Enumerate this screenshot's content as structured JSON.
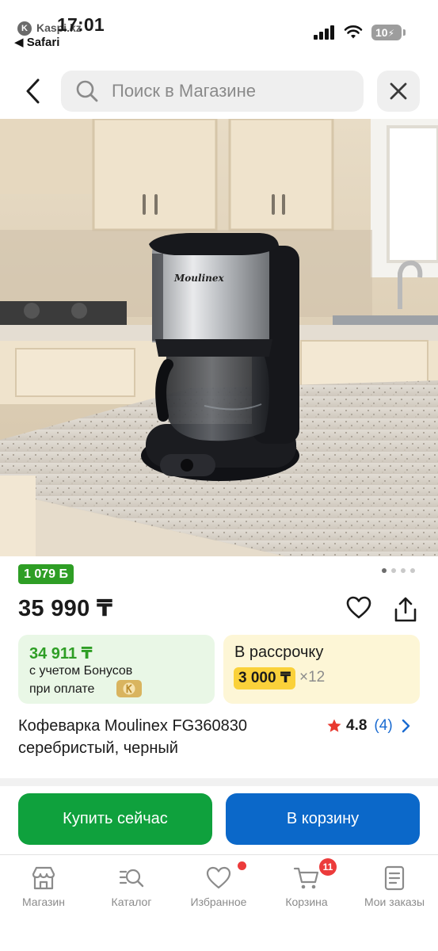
{
  "status_bar": {
    "time": "17:01",
    "app_name": "Kaspi.kz",
    "back_app": "◀ Safari",
    "battery": "10"
  },
  "header": {
    "search_placeholder": "Поиск в Магазине"
  },
  "product": {
    "bonus_badge": "1 079 Б",
    "price": "35 990 ₸",
    "bonus_card": {
      "amount": "34 911 ₸",
      "line1": "с учетом Бонусов",
      "line2": "при оплате"
    },
    "installment_card": {
      "title": "В рассрочку",
      "monthly": "3 000 ₸",
      "months": "×12"
    },
    "title": "Кофеварка Moulinex FG360830 серебристый, черный",
    "rating": "4.8",
    "review_count": "(4)",
    "image_slides": 4,
    "active_slide": 1,
    "brand_on_image": "Moulinex"
  },
  "actions": {
    "buy_now": "Купить сейчас",
    "add_to_cart": "В корзину"
  },
  "tabbar": {
    "items": [
      {
        "label": "Магазин",
        "icon": "store-icon"
      },
      {
        "label": "Каталог",
        "icon": "catalog-search-icon"
      },
      {
        "label": "Избранное",
        "icon": "heart-icon",
        "dot": true
      },
      {
        "label": "Корзина",
        "icon": "cart-icon",
        "badge": "11"
      },
      {
        "label": "Мои заказы",
        "icon": "orders-icon"
      }
    ]
  },
  "colors": {
    "accent_green": "#2e9e25",
    "buy_green": "#0fa13d",
    "cart_blue": "#0b68c9",
    "installment_yellow": "#fad13a",
    "badge_red": "#ec3b3b"
  }
}
